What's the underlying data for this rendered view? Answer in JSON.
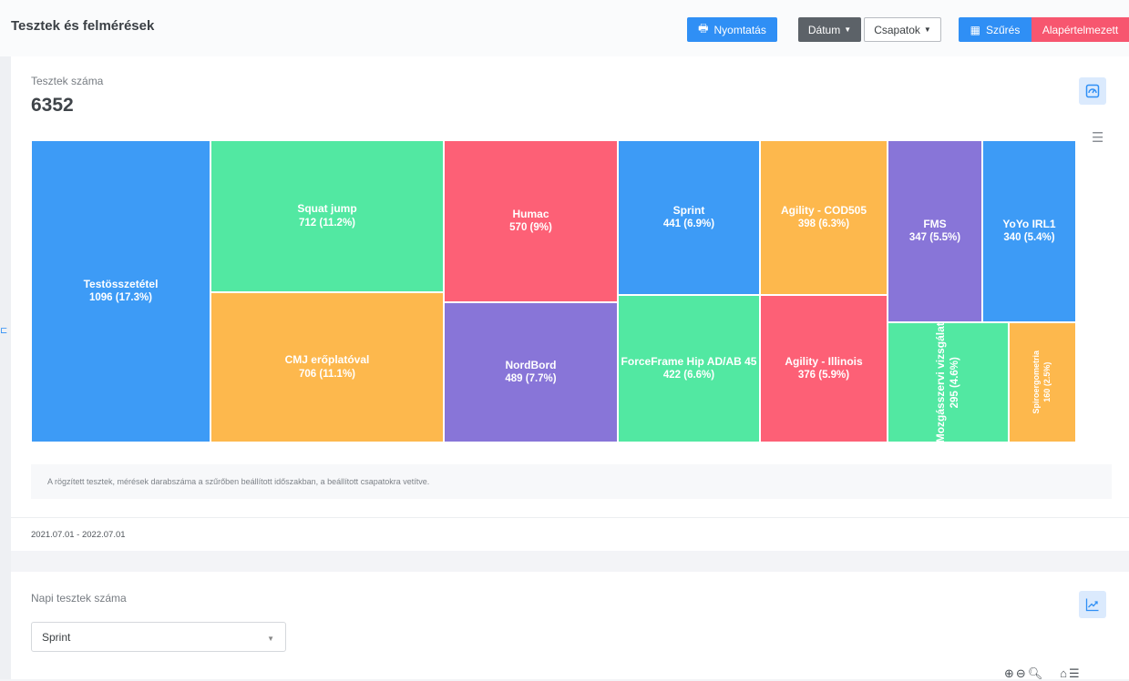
{
  "header": {
    "title": "Tesztek és felmérések",
    "print_label": "Nyomtatás",
    "date_label": "Dátum",
    "teams_label": "Csapatok",
    "filter_label": "Szűrés",
    "default_label": "Alapértelmezett"
  },
  "card_tests": {
    "label": "Tesztek száma",
    "value": "6352",
    "note": "A rögzített tesztek, mérések darabszáma a szűrőben beállított időszakban, a beállított csapatokra vetítve.",
    "date_range": "2021.07.01 - 2022.07.01"
  },
  "chart_data": {
    "type": "treemap",
    "total": 6352,
    "items": [
      {
        "name": "Testösszetétel",
        "value": 1096,
        "percent": "17.3%",
        "label": "1096 (17.3%)",
        "color": "#3d9bf6"
      },
      {
        "name": "Squat jump",
        "value": 712,
        "percent": "11.2%",
        "label": "712 (11.2%)",
        "color": "#52e8a2"
      },
      {
        "name": "CMJ erőplatóval",
        "value": 706,
        "percent": "11.1%",
        "label": "706 (11.1%)",
        "color": "#fdb84d"
      },
      {
        "name": "Humac",
        "value": 570,
        "percent": "9%",
        "label": "570 (9%)",
        "color": "#fd6076"
      },
      {
        "name": "NordBord",
        "value": 489,
        "percent": "7.7%",
        "label": "489 (7.7%)",
        "color": "#8875d8"
      },
      {
        "name": "Sprint",
        "value": 441,
        "percent": "6.9%",
        "label": "441 (6.9%)",
        "color": "#3d9bf6"
      },
      {
        "name": "ForceFrame Hip AD/AB 45",
        "value": 422,
        "percent": "6.6%",
        "label": "422 (6.6%)",
        "color": "#52e8a2"
      },
      {
        "name": "Agility - COD505",
        "value": 398,
        "percent": "6.3%",
        "label": "398 (6.3%)",
        "color": "#fdb84d"
      },
      {
        "name": "Agility - Illinois",
        "value": 376,
        "percent": "5.9%",
        "label": "376 (5.9%)",
        "color": "#fd6076"
      },
      {
        "name": "FMS",
        "value": 347,
        "percent": "5.5%",
        "label": "347 (5.5%)",
        "color": "#8875d8"
      },
      {
        "name": "YoYo IRL1",
        "value": 340,
        "percent": "5.4%",
        "label": "340 (5.4%)",
        "color": "#3d9bf6"
      },
      {
        "name": "Mozgásszervi vizsgálat",
        "value": 295,
        "percent": "4.6%",
        "label": "295 (4.6%)",
        "color": "#52e8a2"
      },
      {
        "name": "Spiroergometria",
        "value": 160,
        "percent": "2.5%",
        "label": "160 (2.5%)",
        "color": "#fdb84d"
      }
    ]
  },
  "card_daily": {
    "label": "Napi tesztek száma",
    "selected_test": "Sprint"
  },
  "icons": {
    "print": "printer-icon",
    "filter": "calendar-icon",
    "chart_card": "gauge-icon",
    "menu": "hamburger-icon",
    "trend": "trend-chart-icon"
  }
}
